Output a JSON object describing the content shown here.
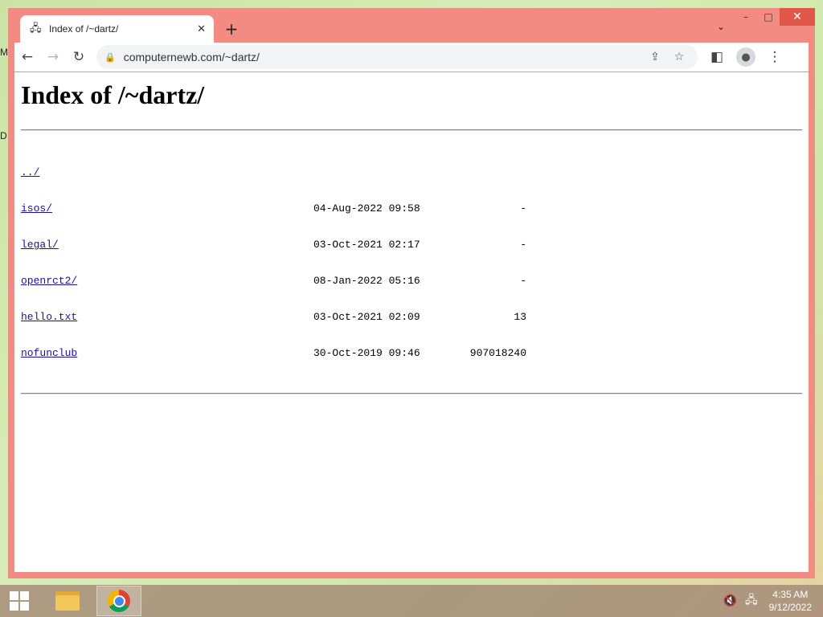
{
  "browser": {
    "tab": {
      "title": "Index of /~dartz/",
      "favicon": "globe-icon"
    },
    "address_bar": {
      "url": "computernewb.com/~dartz/"
    },
    "window_controls": {
      "minimize": "–",
      "maximize": "□",
      "close": "✕"
    }
  },
  "page": {
    "heading": "Index of /~dartz/",
    "entries": [
      {
        "name": "../",
        "date": "",
        "size": ""
      },
      {
        "name": "isos/",
        "date": "04-Aug-2022 09:58",
        "size": "-"
      },
      {
        "name": "legal/",
        "date": "03-Oct-2021 02:17",
        "size": "-"
      },
      {
        "name": "openrct2/",
        "date": "08-Jan-2022 05:16",
        "size": "-"
      },
      {
        "name": "hello.txt",
        "date": "03-Oct-2021 02:09",
        "size": "13"
      },
      {
        "name": "nofunclub",
        "date": "30-Oct-2019 09:46",
        "size": "907018240"
      }
    ]
  },
  "desktop": {
    "fragments": [
      "M",
      "D"
    ]
  },
  "taskbar": {
    "apps": [
      "file-explorer-icon",
      "chrome-icon"
    ],
    "clock": {
      "time": "4:35 AM",
      "date": "9/12/2022"
    }
  },
  "colors": {
    "window_frame": "#f28b82",
    "link": "#1a0dab"
  }
}
